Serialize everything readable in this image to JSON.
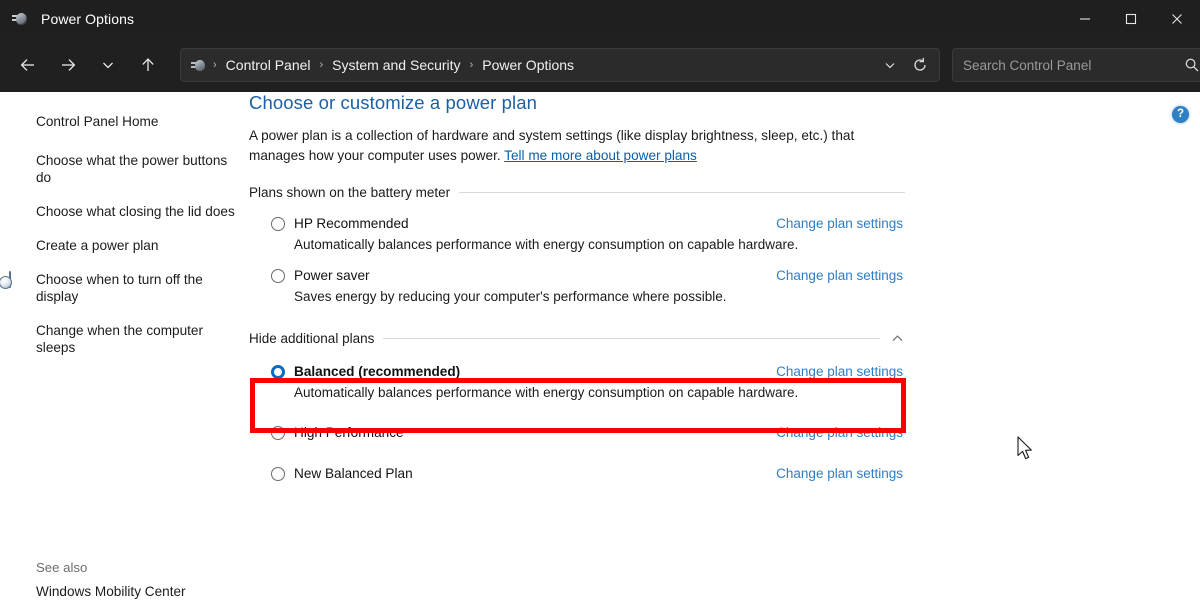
{
  "window": {
    "title": "Power Options",
    "icon": "power-plug-icon",
    "controls": {
      "minimize": "minimize-icon",
      "maximize": "maximize-icon",
      "close": "close-icon"
    }
  },
  "toolbar": {
    "back": "back-arrow-icon",
    "forward": "forward-arrow-icon",
    "recent": "recent-locations-chevron-icon",
    "up": "up-arrow-icon",
    "address": {
      "icon": "power-plug-icon",
      "crumbs": [
        "Control Panel",
        "System and Security",
        "Power Options"
      ],
      "separator": "›",
      "dropdown": "previous-locations-chevron-icon",
      "refresh": "refresh-icon"
    },
    "search": {
      "placeholder": "Search Control Panel",
      "value": "",
      "icon": "search-icon"
    }
  },
  "sidebar": {
    "home": "Control Panel Home",
    "items": [
      {
        "label": "Choose what the power buttons do",
        "icon": null
      },
      {
        "label": "Choose what closing the lid does",
        "icon": null
      },
      {
        "label": "Create a power plan",
        "icon": null
      },
      {
        "label": "Choose when to turn off the display",
        "icon": "display-clock-icon"
      },
      {
        "label": "Change when the computer sleeps",
        "icon": "sleep-moon-icon"
      }
    ],
    "see_also": {
      "title": "See also",
      "links": [
        "Windows Mobility Center"
      ]
    }
  },
  "main": {
    "title": "Choose or customize a power plan",
    "description_part1": "A power plan is a collection of hardware and system settings (like display brightness, sleep, etc.) that manages how your computer uses power. ",
    "description_link": "Tell me more about power plans",
    "help_button": "?",
    "sections": [
      {
        "label": "Plans shown on the battery meter",
        "collapse_icon": null,
        "plans": [
          {
            "name": "HP Recommended",
            "selected": false,
            "bold": false,
            "description": "Automatically balances performance with energy consumption on capable hardware.",
            "action": "Change plan settings"
          },
          {
            "name": "Power saver",
            "selected": false,
            "bold": false,
            "description": "Saves energy by reducing your computer's performance where possible.",
            "action": "Change plan settings"
          }
        ]
      },
      {
        "label": "Hide additional plans",
        "collapse_icon": "chevron-up-icon",
        "plans": [
          {
            "name": "Balanced (recommended)",
            "selected": true,
            "bold": true,
            "description": "Automatically balances performance with energy consumption on capable hardware.",
            "action": "Change plan settings"
          },
          {
            "name": "High Performance",
            "selected": false,
            "bold": false,
            "description": "",
            "action": "Change plan settings"
          },
          {
            "name": "New Balanced Plan",
            "selected": false,
            "bold": false,
            "description": "",
            "action": "Change plan settings"
          }
        ]
      }
    ]
  },
  "annotation": {
    "highlight_color": "#fb0000",
    "highlight_target": "Balanced (recommended)"
  },
  "colors": {
    "titlebar_bg": "#1f1f1f",
    "toolbar_bg": "#202020",
    "content_bg": "#ffffff",
    "heading_blue": "#1b60a5",
    "link_blue": "#2f7dc4",
    "radio_selected": "#0a6cc4"
  }
}
